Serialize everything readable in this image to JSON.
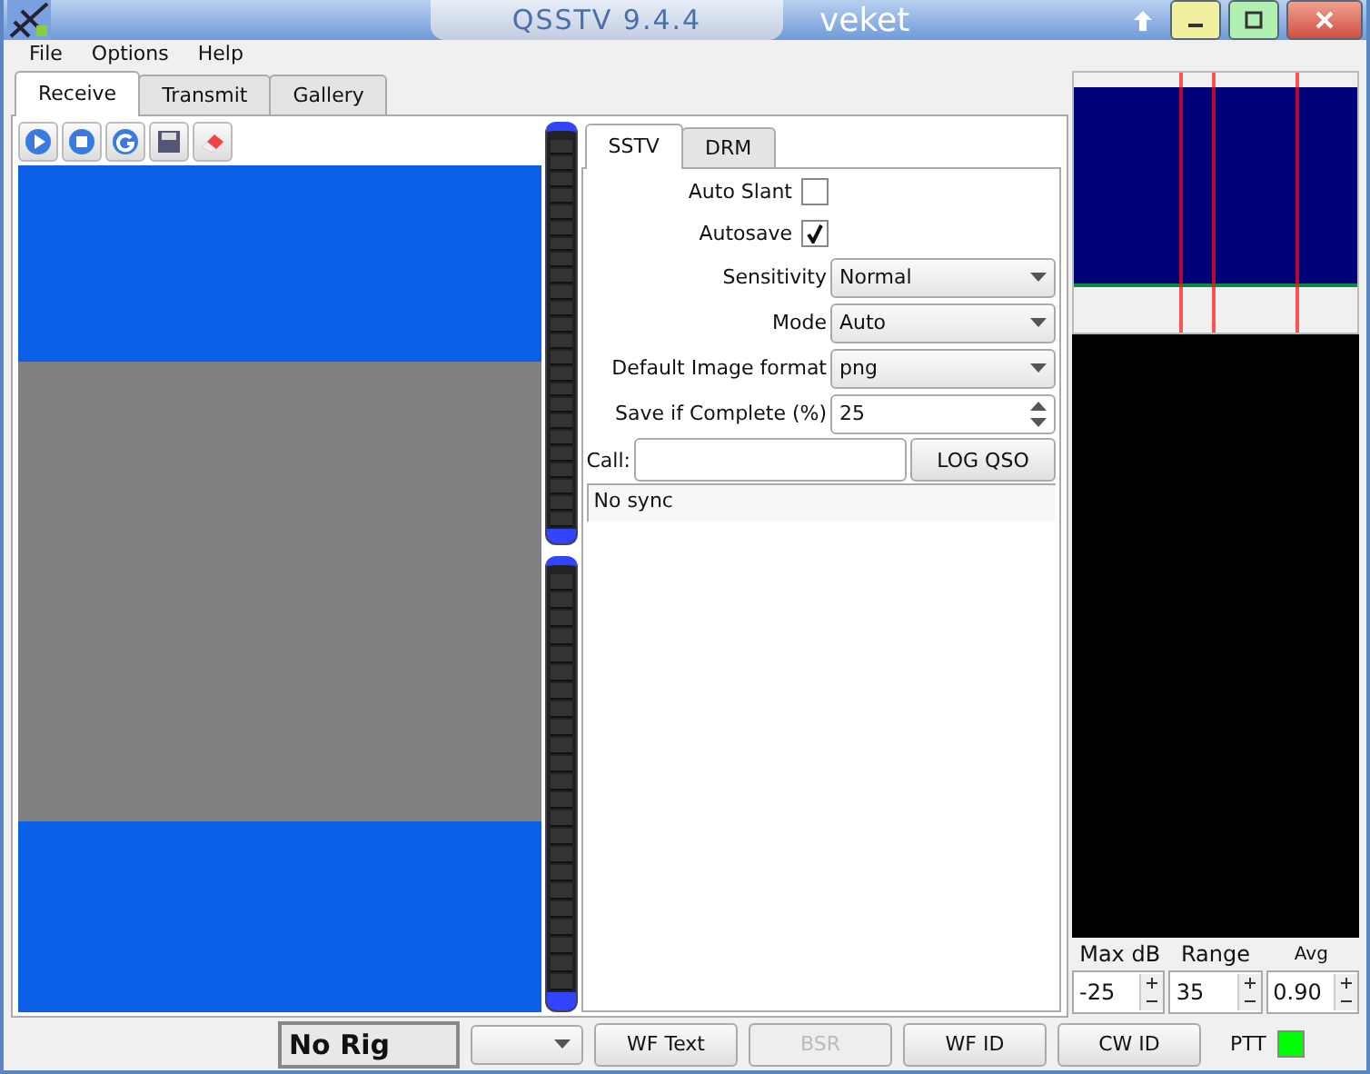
{
  "window": {
    "title": "QSSTV  9.4.4",
    "subtitle": "veket"
  },
  "menu": [
    "File",
    "Options",
    "Help"
  ],
  "tabs": [
    {
      "label": "Receive",
      "selected": true
    },
    {
      "label": "Transmit",
      "selected": false
    },
    {
      "label": "Gallery",
      "selected": false
    }
  ],
  "mode_tabs": [
    {
      "label": "SSTV",
      "selected": true
    },
    {
      "label": "DRM",
      "selected": false
    }
  ],
  "settings": [
    {
      "kind": "checkbox",
      "label": "Auto Slant",
      "checked": false
    },
    {
      "kind": "checkbox",
      "label": "Autosave",
      "checked": true
    },
    {
      "kind": "combo",
      "label": "Sensitivity",
      "value": "Normal"
    },
    {
      "kind": "combo",
      "label": "Mode",
      "value": "Auto"
    },
    {
      "kind": "combo",
      "label": "Default Image format",
      "value": "png"
    },
    {
      "kind": "spin",
      "label": "Save if Complete (%)",
      "value": "25"
    }
  ],
  "call": {
    "label": "Call:",
    "button": "LOG QSO"
  },
  "status": "No sync",
  "spectrum": {
    "labels": [
      "Max dB",
      "Range",
      "Avg"
    ],
    "values": [
      "-25",
      "35",
      "0.90"
    ]
  },
  "bottom": {
    "rig": "No Rig",
    "buttons": [
      {
        "label": "WF Text",
        "disabled": false
      },
      {
        "label": "BSR",
        "disabled": true
      },
      {
        "label": "WF ID",
        "disabled": false
      },
      {
        "label": "CW ID",
        "disabled": false
      }
    ],
    "ptt_label": "PTT",
    "ptt_on": true
  }
}
